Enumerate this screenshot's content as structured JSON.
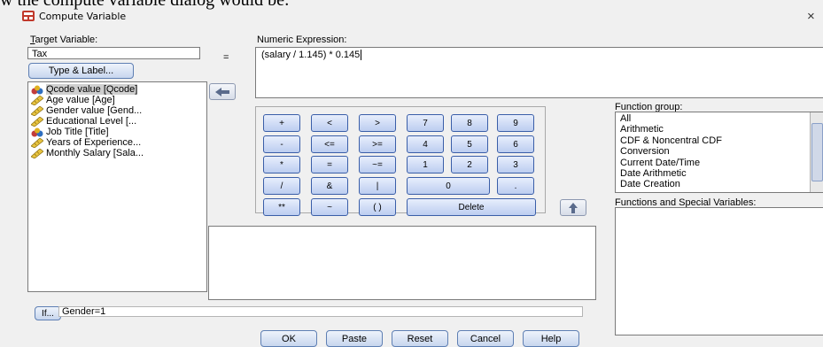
{
  "caption_fragment": "w the compute variable dialog would be:",
  "window": {
    "title": "Compute Variable",
    "close_glyph": "×"
  },
  "target": {
    "label": "Target Variable:",
    "value": "Tax",
    "type_label_button": "Type & Label..."
  },
  "equals": "=",
  "expression": {
    "label": "Numeric Expression:",
    "value": "(salary / 1.145) * 0.145"
  },
  "variables": [
    {
      "label": "Qcode value [Qcode]",
      "icon": "nominal-variable-icon",
      "selected": true
    },
    {
      "label": "Age value [Age]",
      "icon": "scale-variable-icon",
      "selected": false
    },
    {
      "label": "Gender value [Gend...",
      "icon": "scale-variable-icon",
      "selected": false
    },
    {
      "label": "Educational Level [...",
      "icon": "scale-variable-icon",
      "selected": false
    },
    {
      "label": "Job Title [Title]",
      "icon": "nominal-variable-icon",
      "selected": false
    },
    {
      "label": "Years of Experience...",
      "icon": "scale-variable-icon",
      "selected": false
    },
    {
      "label": "Monthly Salary [Sala...",
      "icon": "scale-variable-icon",
      "selected": false
    }
  ],
  "calculator": {
    "rows": [
      [
        "+",
        "<",
        ">",
        "7",
        "8",
        "9"
      ],
      [
        "-",
        "<=",
        ">=",
        "4",
        "5",
        "6"
      ],
      [
        "*",
        "=",
        "~=",
        "1",
        "2",
        "3"
      ],
      [
        "/",
        "&",
        "|",
        "0",
        "."
      ],
      [
        "**",
        "~",
        "( )",
        "Delete"
      ]
    ]
  },
  "function_group": {
    "label": "Function group:",
    "items": [
      "All",
      "Arithmetic",
      "CDF & Noncentral CDF",
      "Conversion",
      "Current Date/Time",
      "Date Arithmetic",
      "Date Creation"
    ]
  },
  "functions_label": "Functions and Special Variables:",
  "if": {
    "button": "If...",
    "condition": "Gender=1"
  },
  "buttons": {
    "ok": "OK",
    "paste": "Paste",
    "reset": "Reset",
    "cancel": "Cancel",
    "help": "Help"
  }
}
